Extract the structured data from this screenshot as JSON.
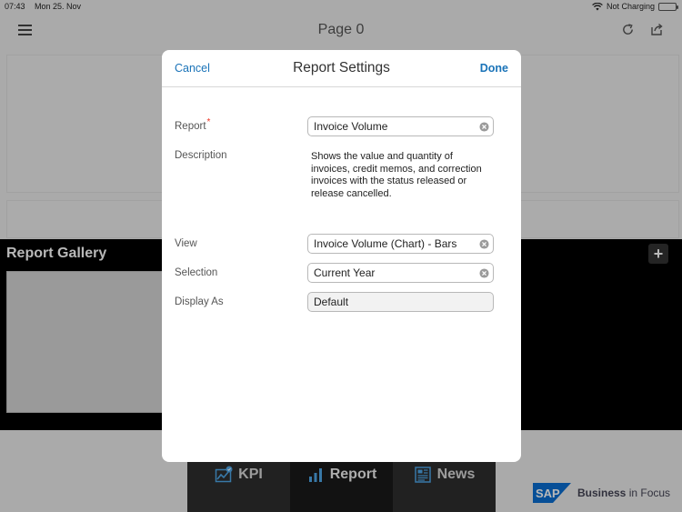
{
  "status_bar": {
    "time": "07:43",
    "date": "Mon 25. Nov",
    "battery_text": "Not Charging"
  },
  "nav": {
    "title": "Page 0"
  },
  "gallery": {
    "title": "Report Gallery",
    "add_label": "+"
  },
  "tabs": [
    {
      "label": "KPI",
      "icon": "kpi-chart-icon"
    },
    {
      "label": "Report",
      "icon": "bar-chart-icon"
    },
    {
      "label": "News",
      "icon": "newspaper-icon"
    }
  ],
  "brand": {
    "logo": "SAP",
    "text_bold": "Business",
    "text_rest": " in Focus"
  },
  "modal": {
    "title": "Report Settings",
    "cancel_label": "Cancel",
    "done_label": "Done",
    "fields": {
      "report": {
        "label": "Report",
        "required_mark": "*",
        "value": "Invoice Volume"
      },
      "description": {
        "label": "Description",
        "value": "Shows the value and quantity of invoices, credit memos, and correction invoices with the status released or release cancelled."
      },
      "view": {
        "label": "View",
        "value": "Invoice Volume (Chart) - Bars"
      },
      "selection": {
        "label": "Selection",
        "value": "Current Year"
      },
      "display_as": {
        "label": "Display As",
        "value": "Default"
      }
    }
  },
  "colors": {
    "accent": "#1a73b8",
    "required": "#e32222",
    "tab_bar": "#2e2e2e",
    "sap_blue": "#0a6ed1"
  }
}
